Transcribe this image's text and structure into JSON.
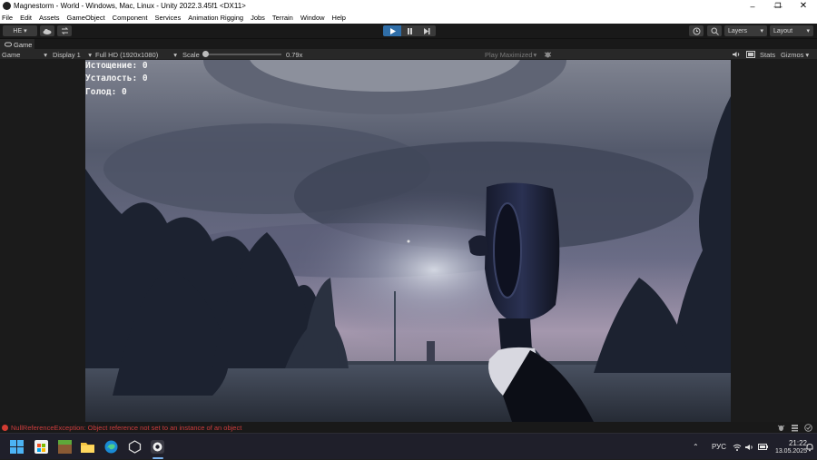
{
  "window": {
    "title": "Magnestorm - World - Windows, Mac, Linux - Unity 2022.3.45f1 <DX11>"
  },
  "menu": [
    "File",
    "Edit",
    "Assets",
    "GameObject",
    "Component",
    "Services",
    "Animation Rigging",
    "Jobs",
    "Terrain",
    "Window",
    "Help"
  ],
  "toolbar": {
    "account_label": "HE ▾",
    "layers_label": "Layers",
    "layout_label": "Layout"
  },
  "tabs": {
    "game": "Game"
  },
  "game_controls": {
    "mode": "Game",
    "display": "Display 1",
    "resolution": "Full HD (1920x1080)",
    "scale_label": "Scale",
    "scale_value": "0.79x",
    "play_mode": "Play Maximized",
    "stats": "Stats",
    "gizmos": "Gizmos"
  },
  "hud": {
    "line1": "Истощение: 0",
    "line2": "Усталость: 0",
    "line3": "Голод: 0"
  },
  "console": {
    "error": "NullReferenceException: Object reference not set to an instance of an object"
  },
  "taskbar": {
    "language": "РУС",
    "time": "21:22",
    "date": "13.05.2025"
  }
}
